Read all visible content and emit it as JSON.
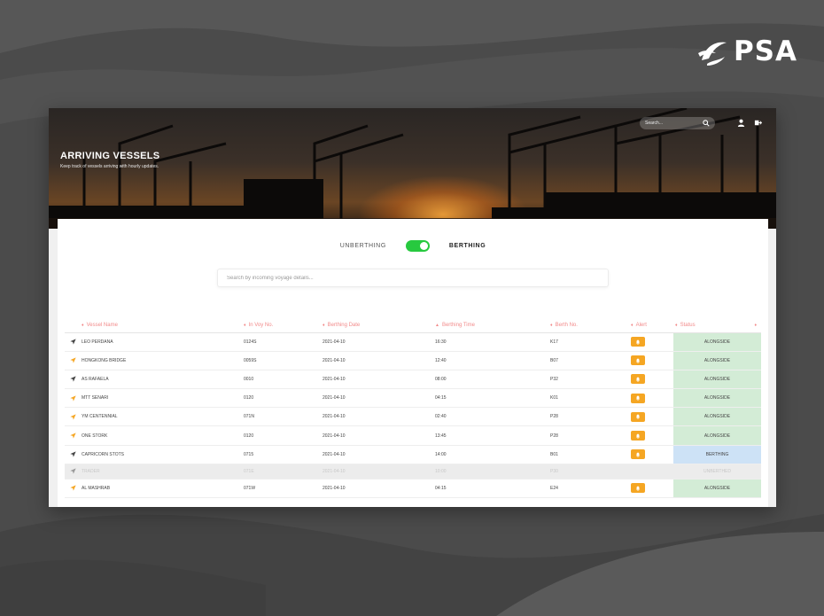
{
  "brand": {
    "name": "PSA"
  },
  "header": {
    "title": "ARRIVING VESSELS",
    "subtitle": "Keep track of vessels arriving with hourly updates.",
    "search_placeholder": "Search..."
  },
  "toggle": {
    "off_label": "UNBERTHING",
    "on_label": "BERTHING",
    "state": "on",
    "color": "#27c93f"
  },
  "voyage_search": {
    "placeholder": "Search by incoming voyage details..."
  },
  "table": {
    "columns": [
      "Vessel Name",
      "In Voy No.",
      "Berthing Date",
      "Berthing Time",
      "Berth No.",
      "Alert",
      "Status"
    ],
    "rows": [
      {
        "name": "LEO PERDANA",
        "voy": "0124S",
        "date": "2021-04-10",
        "time": "16:30",
        "berth": "K17",
        "alert": true,
        "status": "ALONGSIDE",
        "icon": "dark"
      },
      {
        "name": "HONGKONG BRIDGE",
        "voy": "0059S",
        "date": "2021-04-10",
        "time": "12:40",
        "berth": "B07",
        "alert": true,
        "status": "ALONGSIDE",
        "icon": "orange"
      },
      {
        "name": "AS RAFAELA",
        "voy": "0010",
        "date": "2021-04-10",
        "time": "08:00",
        "berth": "P32",
        "alert": true,
        "status": "ALONGSIDE",
        "icon": "dark"
      },
      {
        "name": "MTT SENARI",
        "voy": "0120",
        "date": "2021-04-10",
        "time": "04:15",
        "berth": "K01",
        "alert": true,
        "status": "ALONGSIDE",
        "icon": "orange"
      },
      {
        "name": "YM CENTENNIAL",
        "voy": "071N",
        "date": "2021-04-10",
        "time": "02:40",
        "berth": "P28",
        "alert": true,
        "status": "ALONGSIDE",
        "icon": "orange"
      },
      {
        "name": "ONE STORK",
        "voy": "0120",
        "date": "2021-04-10",
        "time": "13:45",
        "berth": "P28",
        "alert": true,
        "status": "ALONGSIDE",
        "icon": "orange"
      },
      {
        "name": "CAPRICORN STOTS",
        "voy": "0715",
        "date": "2021-04-10",
        "time": "14:00",
        "berth": "B01",
        "alert": true,
        "status": "BERTHING",
        "icon": "dark"
      },
      {
        "name": "TRADER",
        "voy": "071E",
        "date": "2021-04-10",
        "time": "10:00",
        "berth": "P30",
        "alert": false,
        "status": "UNBERTHED",
        "icon": "dark",
        "muted": true
      },
      {
        "name": "AL MASHRAB",
        "voy": "071W",
        "date": "2021-04-10",
        "time": "04:15",
        "berth": "E24",
        "alert": true,
        "status": "ALONGSIDE",
        "icon": "orange"
      }
    ]
  },
  "colors": {
    "header_label": "#f28b8b",
    "alert": "#f5a623",
    "alongside": "#d3ecd6",
    "berthing": "#cde2f6",
    "unberthed": "#f8d6d6"
  }
}
